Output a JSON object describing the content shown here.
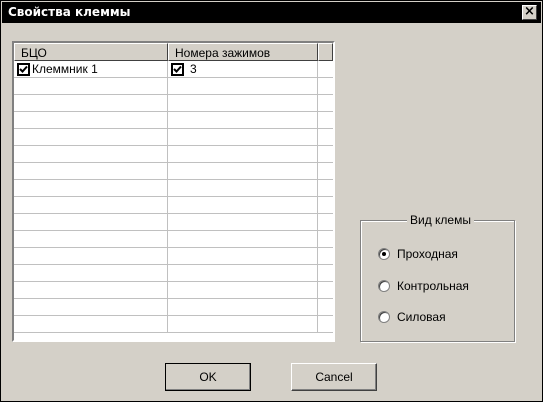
{
  "window": {
    "title": "Свойства клеммы",
    "close_icon": "close-icon"
  },
  "table": {
    "columns": [
      "БЦО",
      "Номера зажимов",
      ""
    ],
    "rows": [
      {
        "col1": {
          "checked": true,
          "text": "Клеммник 1"
        },
        "col2": {
          "checked": true,
          "text": "3"
        }
      }
    ],
    "empty_row_count": 15
  },
  "group": {
    "title": "Вид клемы",
    "options": [
      {
        "label": "Проходная",
        "selected": true
      },
      {
        "label": "Контрольная",
        "selected": false
      },
      {
        "label": "Силовая",
        "selected": false
      }
    ]
  },
  "buttons": {
    "ok": "OK",
    "cancel": "Cancel"
  }
}
